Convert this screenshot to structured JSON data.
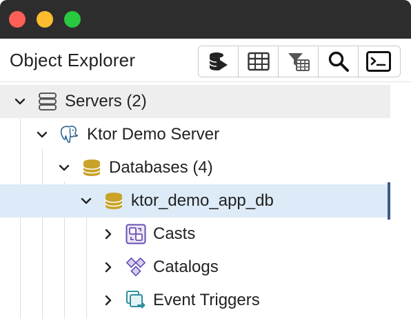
{
  "window": {
    "controls": [
      "close",
      "minimize",
      "zoom"
    ]
  },
  "panel": {
    "title": "Object Explorer"
  },
  "toolbar": {
    "buttons": [
      {
        "name": "query-tool-icon"
      },
      {
        "name": "view-data-icon"
      },
      {
        "name": "filtered-rows-icon"
      },
      {
        "name": "search-icon"
      },
      {
        "name": "psql-tool-icon"
      }
    ]
  },
  "tree": {
    "nodes": [
      {
        "label": "Servers (2)",
        "icon": "servers-icon",
        "expanded": true
      },
      {
        "label": "Ktor Demo Server",
        "icon": "postgres-elephant-icon",
        "expanded": true
      },
      {
        "label": "Databases (4)",
        "icon": "database-icon",
        "expanded": true
      },
      {
        "label": "ktor_demo_app_db",
        "icon": "database-icon",
        "expanded": true,
        "selected": true
      },
      {
        "label": "Casts",
        "icon": "casts-icon",
        "expanded": false
      },
      {
        "label": "Catalogs",
        "icon": "catalogs-icon",
        "expanded": false
      },
      {
        "label": "Event Triggers",
        "icon": "event-triggers-icon",
        "expanded": false
      }
    ]
  },
  "colors": {
    "titlebar": "#2e2d2d",
    "close": "#ff5f57",
    "minimize": "#febc2e",
    "zoom": "#28c840",
    "servers_row_bg": "#eeeeee",
    "selected_row_bg": "#dcebf7",
    "selection_accent": "#3b5b8a",
    "db_icon": "#c9a227",
    "casts_icon": "#6a4fb3"
  }
}
